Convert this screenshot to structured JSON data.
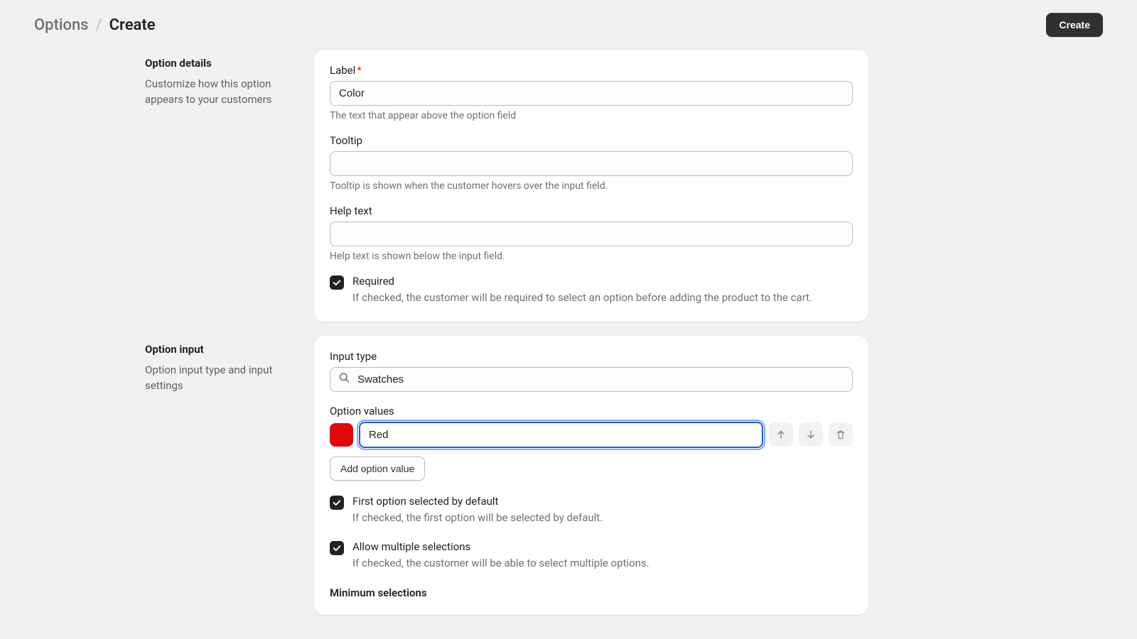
{
  "breadcrumb": {
    "parent": "Options",
    "separator": "/",
    "current": "Create"
  },
  "actions": {
    "create": "Create"
  },
  "sections": {
    "details": {
      "title": "Option details",
      "description": "Customize how this option appears to your customers"
    },
    "input": {
      "title": "Option input",
      "description": "Option input type and input settings"
    }
  },
  "fields": {
    "label": {
      "label": "Label",
      "value": "Color",
      "help": "The text that appear above the option field"
    },
    "tooltip": {
      "label": "Tooltip",
      "value": "",
      "help": "Tooltip is shown when the customer hovers over the input field."
    },
    "helpText": {
      "label": "Help text",
      "value": "",
      "help": "Help text is shown below the input field."
    },
    "required": {
      "label": "Required",
      "help": "If checked, the customer will be required to select an option before adding the product to the cart."
    },
    "inputType": {
      "label": "Input type",
      "value": "Swatches"
    },
    "optionValues": {
      "label": "Option values",
      "addButton": "Add option value",
      "values": [
        {
          "name": "Red",
          "color": "#e1090c"
        }
      ]
    },
    "firstSelected": {
      "label": "First option selected by default",
      "help": "If checked, the first option will be selected by default."
    },
    "allowMultiple": {
      "label": "Allow multiple selections",
      "help": "If checked, the customer will be able to select multiple options."
    },
    "minSelections": {
      "label": "Minimum selections"
    }
  }
}
